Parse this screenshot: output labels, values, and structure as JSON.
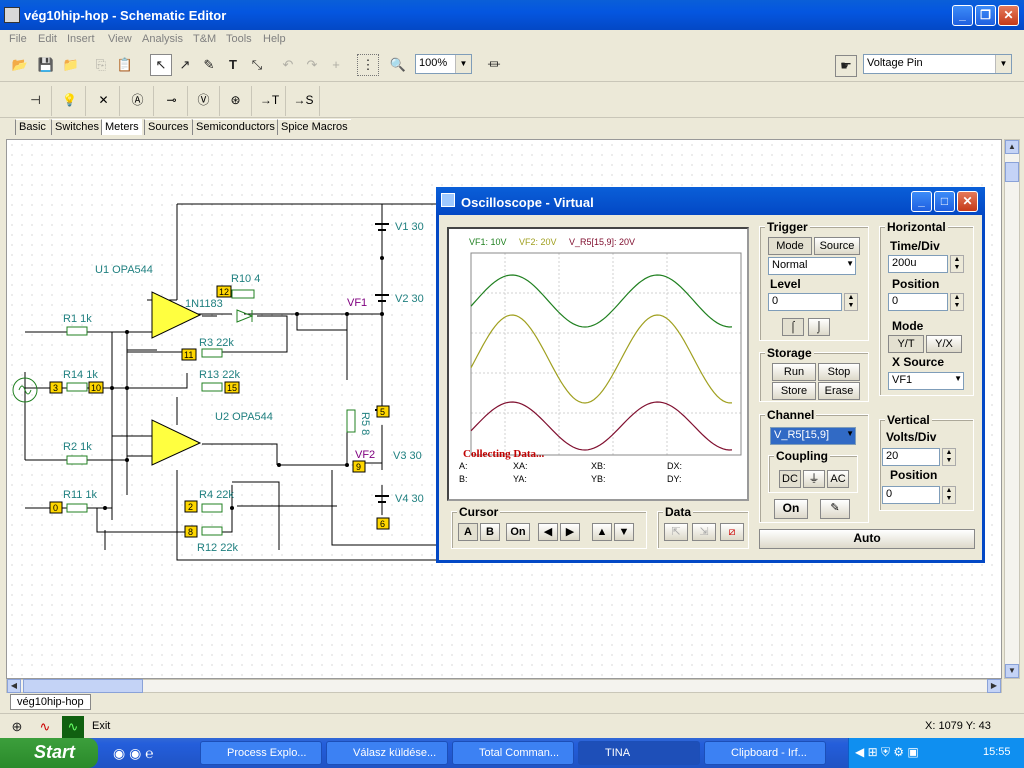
{
  "window": {
    "title": "vég10hip-hop - Schematic Editor"
  },
  "menu": [
    "File",
    "Edit",
    "Insert",
    "View",
    "Analysis",
    "T&M",
    "Tools",
    "Help"
  ],
  "toolbar": {
    "zoom": "100%",
    "pin_select": "Voltage Pin"
  },
  "tabs": [
    "Basic",
    "Switches",
    "Meters",
    "Sources",
    "Semiconductors",
    "Spice Macros"
  ],
  "schematic": {
    "labels": [
      "U1 OPA544",
      "R1 1k",
      "R14 1k",
      "R2 1k",
      "R11 1k",
      "1N1183",
      "R10 4",
      "R3 22k",
      "R13 22k",
      "U2 OPA544",
      "R4 22k",
      "R12 22k",
      "V1 30",
      "V2 30",
      "V3 30",
      "V4 30",
      "VF1",
      "VF2",
      "R5 8"
    ],
    "nodes": [
      "12",
      "11",
      "15",
      "3",
      "10",
      "2",
      "8",
      "0",
      "5",
      "9",
      "6"
    ]
  },
  "scope": {
    "title": "Oscilloscope - Virtual",
    "channels_header": [
      "VF1: 10V",
      "VF2: 20V",
      "V_R5[15,9]: 20V"
    ],
    "status": "Collecting Data...",
    "readouts": [
      "A:",
      "XA:",
      "XB:",
      "DX:",
      "B:",
      "YA:",
      "YB:",
      "DY:"
    ],
    "trigger": {
      "title": "Trigger",
      "mode": "Mode",
      "source": "Source",
      "mode_value": "Normal",
      "level_label": "Level",
      "level": "0"
    },
    "horizontal": {
      "title": "Horizontal",
      "time_div_label": "Time/Div",
      "time_div": "200u",
      "position_label": "Position",
      "position": "0",
      "mode_label": "Mode",
      "yt": "Y/T",
      "yx": "Y/X",
      "xsource_label": "X Source",
      "xsource": "VF1"
    },
    "storage": {
      "title": "Storage",
      "run": "Run",
      "stop": "Stop",
      "store": "Store",
      "erase": "Erase"
    },
    "channel": {
      "title": "Channel",
      "value": "V_R5[15,9]",
      "coupling": "Coupling",
      "dc": "DC",
      "ground": "⏚",
      "ac": "AC",
      "on": "On"
    },
    "vertical": {
      "title": "Vertical",
      "volts_div_label": "Volts/Div",
      "volts_div": "20",
      "position_label": "Position",
      "position": "0"
    },
    "cursor": {
      "title": "Cursor",
      "a": "A",
      "b": "B",
      "on": "On"
    },
    "data": {
      "title": "Data"
    },
    "auto": "Auto"
  },
  "doc_tab": "vég10hip-hop",
  "statusbar": {
    "exit": "Exit",
    "coords": "X: 1079  Y: 43"
  },
  "taskbar": {
    "start": "Start",
    "tasks": [
      "Process Explo...",
      "Válasz küldése...",
      "Total Comman...",
      "TINA",
      "Clipboard - Irf..."
    ],
    "clock": "15:55"
  },
  "colors": {
    "trace1": "#208020",
    "trace2": "#a0a020",
    "trace3": "#801030",
    "xp_blue": "#0348c5"
  }
}
